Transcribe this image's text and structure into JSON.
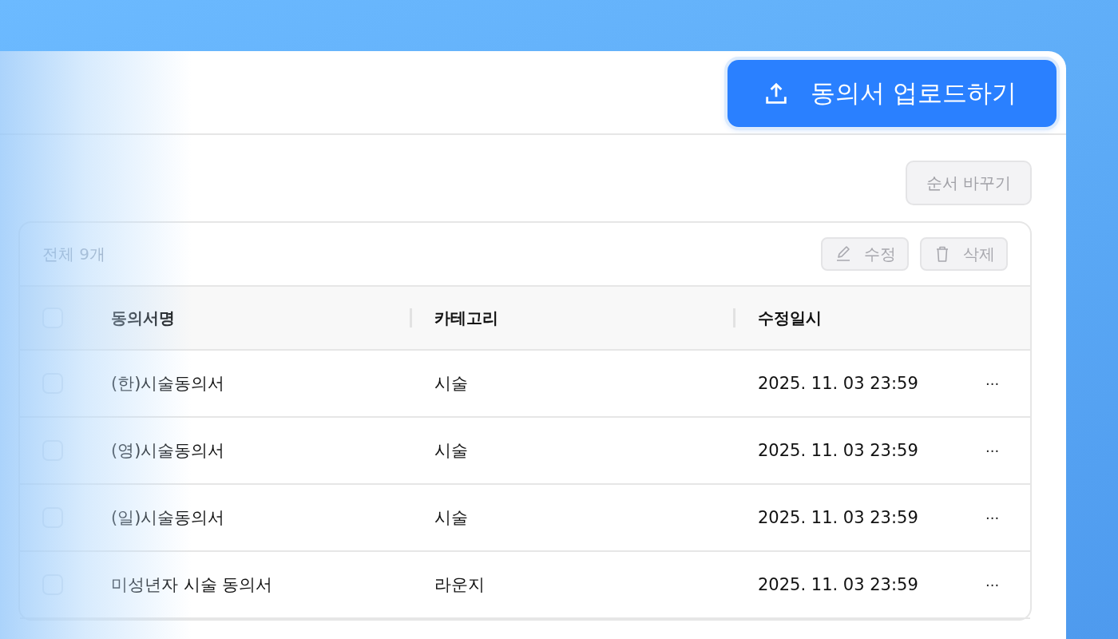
{
  "upload_button": {
    "label": "동의서 업로드하기"
  },
  "reorder_button": {
    "label": "순서 바꾸기",
    "disabled": true
  },
  "table": {
    "total": "전체 9개",
    "actions": [
      {
        "kind": "edit",
        "label": "수정",
        "disabled": true
      },
      {
        "kind": "delete",
        "label": "삭제",
        "disabled": true
      }
    ],
    "select_all": {
      "checked": false
    },
    "columns": [
      "동의서명",
      "카테고리",
      "수정일시"
    ],
    "rows": [
      {
        "checked": false,
        "name": "(한)시술동의서",
        "category": "시술",
        "modified": "2025. 11. 03 23:59",
        "more": "···"
      },
      {
        "checked": false,
        "name": "(영)시술동의서",
        "category": "시술",
        "modified": "2025. 11. 03 23:59",
        "more": "···"
      },
      {
        "checked": false,
        "name": "(일)시술동의서",
        "category": "시술",
        "modified": "2025. 11. 03 23:59",
        "more": "···"
      },
      {
        "checked": false,
        "name": "미성년자 시술 동의서",
        "category": "라운지",
        "modified": "2025. 11. 03 23:59",
        "more": "···"
      }
    ]
  }
}
